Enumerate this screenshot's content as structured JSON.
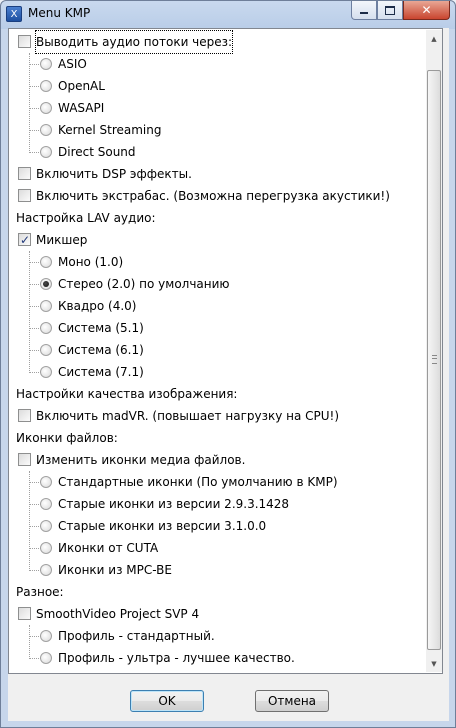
{
  "window": {
    "title": "Menu KMP",
    "app_icon_glyph": "X"
  },
  "audio_output": {
    "label": "Выводить аудио потоки через:",
    "checked": false,
    "options": [
      "ASIO",
      "OpenAL",
      "WASAPI",
      "Kernel Streaming",
      "Direct Sound"
    ]
  },
  "dsp": {
    "label": "Включить DSP эффекты.",
    "checked": false
  },
  "extrabass": {
    "label": "Включить экстрабас. (Возможна перегрузка акустики!)",
    "checked": false
  },
  "lav": {
    "section_label": "Настройка LAV аудио:",
    "mixer": {
      "label": "Микшер",
      "checked": true
    },
    "options": [
      "Моно (1.0)",
      "Стерео (2.0) по умолчанию",
      "Квадро (4.0)",
      "Система (5.1)",
      "Система (6.1)",
      "Система (7.1)"
    ],
    "selected": "Стерео (2.0) по умолчанию"
  },
  "image_quality": {
    "section_label": "Настройки качества изображения:",
    "madvr": {
      "label": "Включить madVR. (повышает нагрузку на CPU!)",
      "checked": false
    }
  },
  "file_icons": {
    "section_label": "Иконки файлов:",
    "change": {
      "label": "Изменить иконки медиа файлов.",
      "checked": false
    },
    "options": [
      "Стандартные иконки (По умолчанию в KMP)",
      "Старые иконки из версии 2.9.3.1428",
      "Старые иконки из версии 3.1.0.0",
      "Иконки от CUTA",
      "Иконки из MPC-BE"
    ]
  },
  "misc": {
    "section_label": "Разное:",
    "svp": {
      "label": "SmoothVideo Project SVP 4",
      "checked": false
    },
    "options": [
      "Профиль - стандартный.",
      "Профиль - ультра - лучшее качество."
    ]
  },
  "buttons": {
    "ok": "OK",
    "cancel": "Отмена"
  },
  "icons": {
    "minimize": "minimize-icon",
    "maximize": "maximize-icon",
    "close": "close-icon",
    "scroll_up": "arrow-up-icon",
    "scroll_down": "arrow-down-icon"
  }
}
